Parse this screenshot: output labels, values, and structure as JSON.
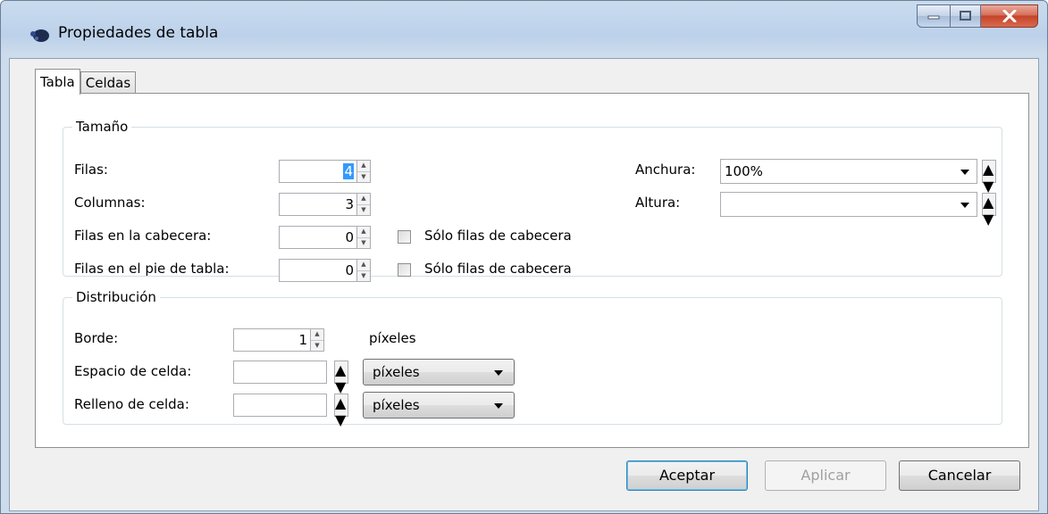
{
  "window": {
    "title": "Propiedades de tabla"
  },
  "tabs": [
    {
      "label": "Tabla"
    },
    {
      "label": "Celdas"
    }
  ],
  "size": {
    "legend": "Tamaño",
    "rows_label": "Filas:",
    "rows_value": "4",
    "columns_label": "Columnas:",
    "columns_value": "3",
    "header_rows_label": "Filas en la cabecera:",
    "header_rows_value": "0",
    "footer_rows_label": "Filas en el pie de tabla:",
    "footer_rows_value": "0",
    "header_only_label": "Sólo filas de cabecera",
    "footer_only_label": "Sólo filas de cabecera",
    "width_label": "Anchura:",
    "width_value": "100%",
    "height_label": "Altura:",
    "height_value": ""
  },
  "layout": {
    "legend": "Distribución",
    "border_label": "Borde:",
    "border_value": "1",
    "border_unit": "píxeles",
    "spacing_label": "Espacio de celda:",
    "spacing_value": "",
    "spacing_unit": "píxeles",
    "padding_label": "Relleno de celda:",
    "padding_value": "",
    "padding_unit": "píxeles"
  },
  "buttons": {
    "accept": "Aceptar",
    "apply": "Aplicar",
    "cancel": "Cancelar"
  },
  "colors": {
    "selection": "#3399ff",
    "title_bar": "#bcd1ea",
    "close_button": "#c5432a"
  }
}
